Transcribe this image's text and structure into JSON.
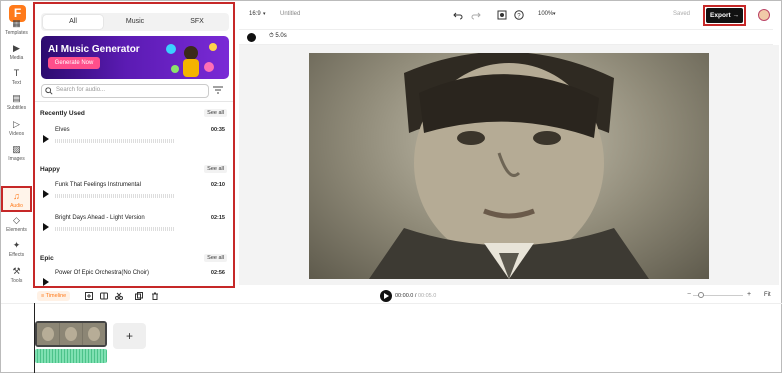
{
  "app": {
    "logo": "F",
    "project_name": "Untitled",
    "status": "Saved",
    "aspect_ratio": "16:9",
    "zoom": "100%",
    "export_label": "Export",
    "accent_color": "#ff7a1a"
  },
  "rail": [
    {
      "name": "templates",
      "label": "Templates"
    },
    {
      "name": "media",
      "label": "Media"
    },
    {
      "name": "text",
      "label": "Text"
    },
    {
      "name": "subtitles",
      "label": "Subtitles"
    },
    {
      "name": "videos",
      "label": "Videos"
    },
    {
      "name": "images",
      "label": "Images"
    },
    {
      "name": "audio",
      "label": "Audio"
    },
    {
      "name": "elements",
      "label": "Elements"
    },
    {
      "name": "effects",
      "label": "Effects"
    },
    {
      "name": "tools",
      "label": "Tools"
    }
  ],
  "panel": {
    "tabs": [
      "All",
      "Music",
      "SFX"
    ],
    "banner": {
      "title": "AI Music Generator",
      "button": "Generate Now"
    },
    "search_placeholder": "Search for audio...",
    "see_all": "See all",
    "sections": [
      {
        "title": "Recently Used",
        "tracks": [
          {
            "name": "Elves",
            "duration": "00:35"
          }
        ]
      },
      {
        "title": "Happy",
        "tracks": [
          {
            "name": "Funk That Feelings Instrumental",
            "duration": "02:10"
          },
          {
            "name": "Bright Days Ahead - Light Version",
            "duration": "02:15"
          }
        ]
      },
      {
        "title": "Epic",
        "tracks": [
          {
            "name": "Power Of Epic Orchestra(No Choir)",
            "duration": "02:56"
          }
        ]
      }
    ]
  },
  "canvas": {
    "duration_chip": "5.0s"
  },
  "timeline": {
    "label": "Timeline",
    "current": "00:00.0",
    "total": "00:05.0",
    "fit": "Fit",
    "add": "+"
  }
}
